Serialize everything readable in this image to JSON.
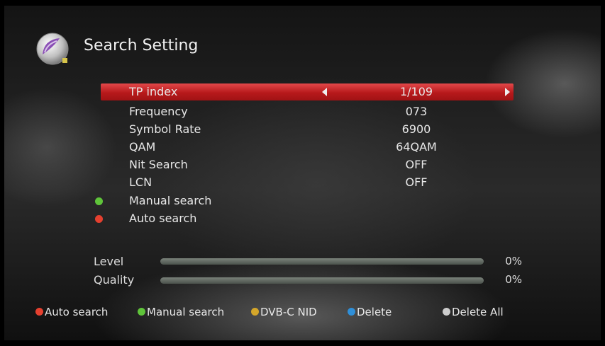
{
  "header": {
    "title": "Search Setting",
    "icon": "satellite-dish-icon"
  },
  "settings": [
    {
      "label": "TP index",
      "value": "1/109",
      "selected": true
    },
    {
      "label": "Frequency",
      "value": "073"
    },
    {
      "label": "Symbol Rate",
      "value": "6900"
    },
    {
      "label": "QAM",
      "value": "64QAM"
    },
    {
      "label": "Nit Search",
      "value": "OFF"
    },
    {
      "label": "LCN",
      "value": "OFF"
    }
  ],
  "actions": [
    {
      "label": "Manual search",
      "color": "#5fc43a"
    },
    {
      "label": "Auto search",
      "color": "#e5402f"
    }
  ],
  "meters": [
    {
      "label": "Level",
      "value": "0%",
      "level": 0
    },
    {
      "label": "Quality",
      "value": "0%",
      "level": 0
    }
  ],
  "footer": [
    {
      "label": "Auto search",
      "color": "#e5402f"
    },
    {
      "label": "Manual search",
      "color": "#5fc43a"
    },
    {
      "label": "DVB-C NID",
      "color": "#d4a62a"
    },
    {
      "label": "Delete",
      "color": "#2f8fd8"
    },
    {
      "label": "Delete All",
      "color": "#cccccc"
    }
  ],
  "colors": {
    "highlight": "#c62325",
    "background": "#1a1a1a"
  }
}
